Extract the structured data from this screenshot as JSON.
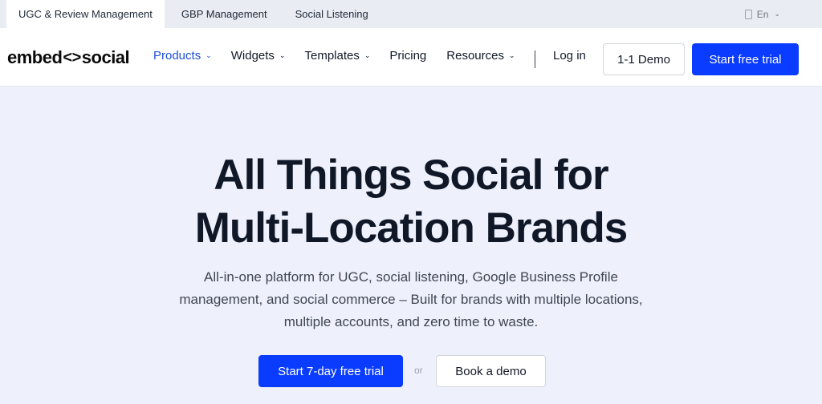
{
  "topbar": {
    "tabs": [
      {
        "label": "UGC & Review Management"
      },
      {
        "label": "GBP Management"
      },
      {
        "label": "Social Listening"
      }
    ],
    "language": "En"
  },
  "nav": {
    "logo_left": "embed",
    "logo_mark": "<>",
    "logo_right": "social",
    "items": [
      {
        "label": "Products"
      },
      {
        "label": "Widgets"
      },
      {
        "label": "Templates"
      },
      {
        "label": "Pricing"
      },
      {
        "label": "Resources"
      }
    ],
    "login": "Log in",
    "demo_button": "1-1 Demo",
    "trial_button": "Start free trial"
  },
  "hero": {
    "title_line1": "All Things Social for",
    "title_line2": "Multi-Location Brands",
    "subtitle": "All-in-one platform for UGC, social listening, Google Business Profile management, and social commerce – Built for brands with multiple locations, multiple accounts, and zero time to waste.",
    "cta_primary": "Start 7-day free trial",
    "cta_or": "or",
    "cta_secondary": "Book a demo"
  },
  "colors": {
    "accent": "#0a3cff",
    "active_nav": "#1d4ed8",
    "hero_bg": "#eef1fb"
  }
}
